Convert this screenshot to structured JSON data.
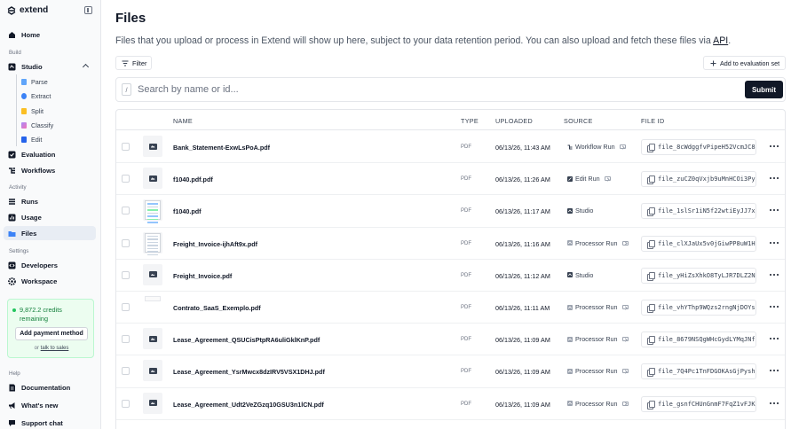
{
  "brand": {
    "name": "extend"
  },
  "sidebar": {
    "home": "Home",
    "build_label": "Build",
    "studio": "Studio",
    "studio_items": [
      "Parse",
      "Extract",
      "Split",
      "Classify",
      "Edit"
    ],
    "evaluation": "Evaluation",
    "workflows": "Workflows",
    "activity_label": "Activity",
    "runs": "Runs",
    "usage": "Usage",
    "files": "Files",
    "settings_label": "Settings",
    "developers": "Developers",
    "workspace": "Workspace",
    "credits_text": "9,872.2 credits remaining",
    "add_payment": "Add payment method",
    "sales_prefix": "or ",
    "sales_link": "talk to sales",
    "help_label": "Help",
    "documentation": "Documentation",
    "whats_new": "What's new",
    "support_chat": "Support chat"
  },
  "main": {
    "title": "Files",
    "subtitle": "Files that you upload or process in Extend will show up here, subject to your data retention period. You can also upload and fetch these files via ",
    "subtitle_link": "API",
    "subtitle_end": ".",
    "filter_label": "Filter",
    "eval_set_label": "Add to evaluation set",
    "search_key": "/",
    "search_placeholder": "Search by name or id...",
    "submit_label": "Submit"
  },
  "table": {
    "headers": {
      "name": "NAME",
      "type": "TYPE",
      "uploaded": "UPLOADED",
      "source": "SOURCE",
      "file_id": "FILE ID"
    },
    "rows": [
      {
        "name": "Bank_Statement-ExwLsPoA.pdf",
        "type": "PDF",
        "uploaded": "06/13/26, 11:43 AM",
        "source": "Workflow Run",
        "source_icon": "workflow-icon",
        "file_id": "file_8cWdggfvPipeH52VcmJC8",
        "thumb": "image"
      },
      {
        "name": "f1040.pdf.pdf",
        "type": "PDF",
        "uploaded": "06/13/26, 11:26 AM",
        "source": "Edit Run",
        "source_icon": "edit-icon",
        "file_id": "file_zuCZ0qVxjb9uMnHCOi3Py",
        "thumb": "image"
      },
      {
        "name": "f1040.pdf",
        "type": "PDF",
        "uploaded": "06/13/26, 11:17 AM",
        "source": "Studio",
        "source_icon": "studio-icon",
        "file_id": "file_1slSr1iN5f22wtiEyJJ7x",
        "thumb": "color"
      },
      {
        "name": "Freight_Invoice-ijhAft9x.pdf",
        "type": "PDF",
        "uploaded": "06/13/26, 11:16 AM",
        "source": "Processor Run",
        "source_icon": "processor-icon",
        "file_id": "file_clXJaUx5v0jGiwPP8uW1H",
        "thumb": "doc"
      },
      {
        "name": "Freight_Invoice.pdf",
        "type": "PDF",
        "uploaded": "06/13/26, 11:12 AM",
        "source": "Studio",
        "source_icon": "studio-icon",
        "file_id": "file_yHiZsXhkO8TyLJR7DLZ2N",
        "thumb": "image"
      },
      {
        "name": "Contrato_SaaS_Exemplo.pdf",
        "type": "PDF",
        "uploaded": "06/13/26, 11:11 AM",
        "source": "Processor Run",
        "source_icon": "processor-icon",
        "file_id": "file_vhYThp9WQzs2rngNjDOYs",
        "thumb": "blank"
      },
      {
        "name": "Lease_Agreement_QSUCisPtpRA6uliGklKnP.pdf",
        "type": "PDF",
        "uploaded": "06/13/26, 11:09 AM",
        "source": "Processor Run",
        "source_icon": "processor-icon",
        "file_id": "file_8679NSQgWHcGydLYMqJNf",
        "thumb": "image"
      },
      {
        "name": "Lease_Agreement_YsrMwcx8dzIRV5VSX1DHJ.pdf",
        "type": "PDF",
        "uploaded": "06/13/26, 11:09 AM",
        "source": "Processor Run",
        "source_icon": "processor-icon",
        "file_id": "file_7Q4Pc1TnFDGOKAsGjPysh",
        "thumb": "image"
      },
      {
        "name": "Lease_Agreement_Udt2VeZGzq10GSU3n1lCN.pdf",
        "type": "PDF",
        "uploaded": "06/13/26, 11:09 AM",
        "source": "Processor Run",
        "source_icon": "processor-icon",
        "file_id": "file_gsnfCHUnGnmF7FqZ1vFJK",
        "thumb": "image"
      }
    ]
  },
  "colors": {
    "accent": "#111827",
    "active_nav": "#e8edf4",
    "credits_bg": "#ecfdf0",
    "credits_text": "#15803d"
  }
}
